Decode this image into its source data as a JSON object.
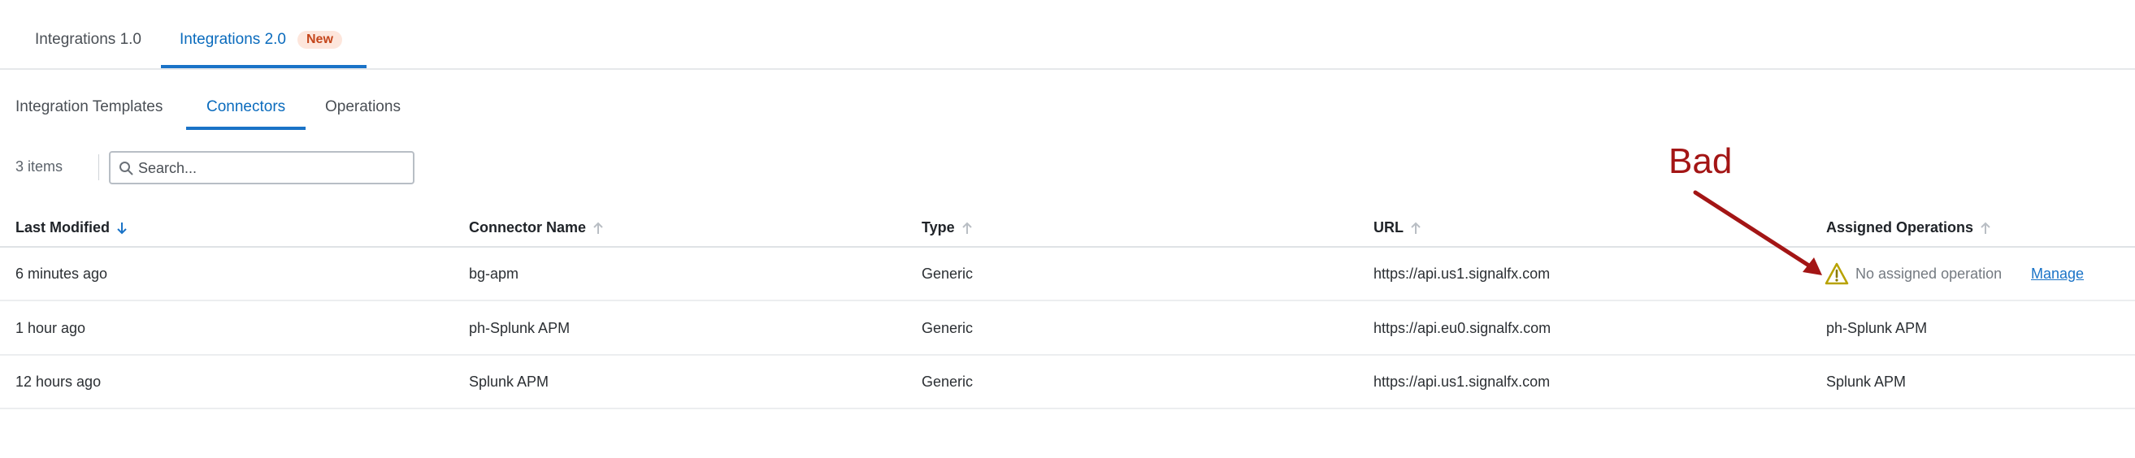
{
  "top_tabs": [
    {
      "label": "Integrations 1.0"
    },
    {
      "label": "Integrations 2.0",
      "badge": "New"
    }
  ],
  "sub_tabs": [
    {
      "label": "Integration Templates"
    },
    {
      "label": "Connectors"
    },
    {
      "label": "Operations"
    }
  ],
  "toolbar": {
    "items_count": "3 items",
    "search_placeholder": "Search..."
  },
  "table": {
    "headers": [
      "Last Modified",
      "Connector Name",
      "Type",
      "URL",
      "Assigned Operations"
    ],
    "rows": [
      {
        "last_modified": "6 minutes ago",
        "connector_name": "bg-apm",
        "type": "Generic",
        "url": "https://api.us1.signalfx.com",
        "assigned": "No assigned operation",
        "action": "Manage"
      },
      {
        "last_modified": "1 hour ago",
        "connector_name": "ph-Splunk APM",
        "type": "Generic",
        "url": "https://api.eu0.signalfx.com",
        "assigned": "ph-Splunk APM"
      },
      {
        "last_modified": "12 hours ago",
        "connector_name": "Splunk APM",
        "type": "Generic",
        "url": "https://api.us1.signalfx.com",
        "assigned": "Splunk APM"
      }
    ]
  },
  "annotation": {
    "label": "Bad",
    "color": "#a31515"
  },
  "colors": {
    "accent": "#1a73c7",
    "badge_text": "#c4461b",
    "badge_bg": "#fde6dc",
    "warning": "#b8a200"
  },
  "icons": {
    "search": "search-icon",
    "sort_active": "arrow-down-icon",
    "sort_inactive": "arrow-up-icon",
    "warning": "warning-triangle-icon"
  }
}
